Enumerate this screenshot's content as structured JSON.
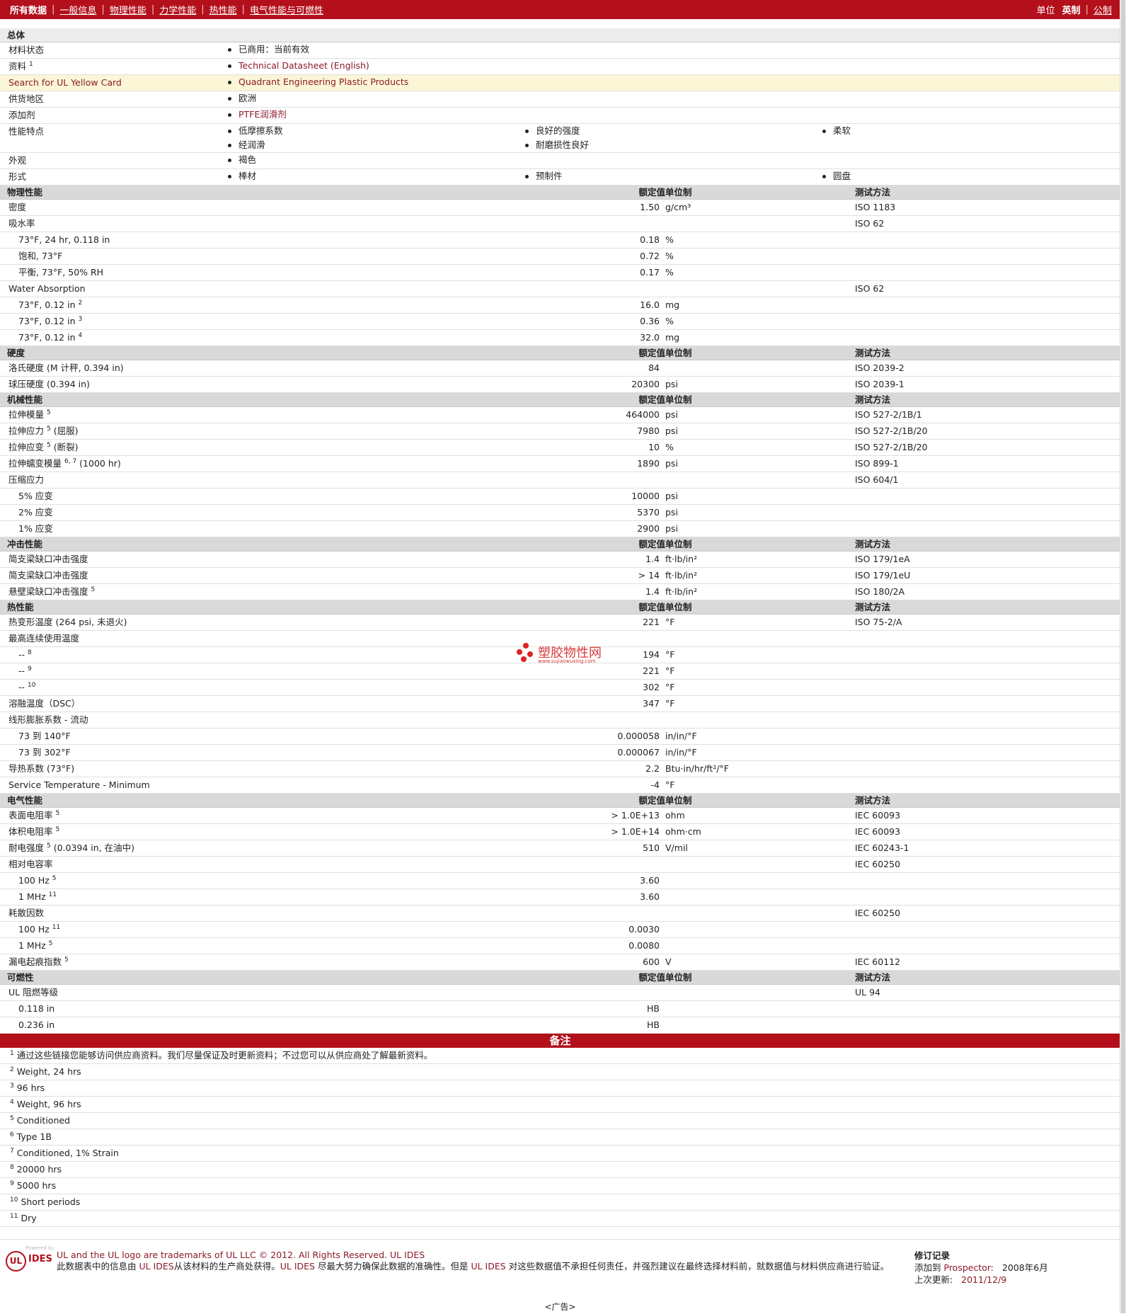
{
  "topbar": {
    "all_data": "所有数据",
    "tabs": [
      "一般信息",
      "物理性能",
      "力学性能",
      "热性能",
      "电气性能与可燃性"
    ],
    "units_label": "单位",
    "unit_active": "英制",
    "unit_other": "公制"
  },
  "general": {
    "section": "总体",
    "status_label": "材料状态",
    "status_value": "已商用：当前有效",
    "source_label": "资料",
    "source_sup": "1",
    "source_value": "Technical Datasheet (English)",
    "ul_label": "Search for UL Yellow Card",
    "ul_value": "Quadrant Engineering Plastic Products",
    "region_label": "供货地区",
    "region_value": "欧洲",
    "additive_label": "添加剂",
    "additive_value": "PTFE润滑剂",
    "features_label": "性能特点",
    "features": [
      "低摩擦系数",
      "良好的强度",
      "柔软",
      "经润滑",
      "耐磨损性良好"
    ],
    "appearance_label": "外观",
    "appearance_value": "褐色",
    "form_label": "形式",
    "forms": [
      "棒材",
      "预制件",
      "圆盘"
    ]
  },
  "headers": {
    "value": "额定值",
    "unit": "单位制",
    "test": "测试方法"
  },
  "physical": {
    "section": "物理性能",
    "rows": [
      {
        "label": "密度",
        "sup": "",
        "extra": "",
        "indent": false,
        "value": "1.50",
        "unit": "g/cm³",
        "test": "ISO 1183"
      },
      {
        "label": "吸水率",
        "sup": "",
        "extra": "",
        "indent": false,
        "value": "",
        "unit": "",
        "test": "ISO 62"
      },
      {
        "label": "73°F, 24 hr, 0.118 in",
        "sup": "",
        "extra": "",
        "indent": true,
        "value": "0.18",
        "unit": "%",
        "test": ""
      },
      {
        "label": "饱和, 73°F",
        "sup": "",
        "extra": "",
        "indent": true,
        "value": "0.72",
        "unit": "%",
        "test": ""
      },
      {
        "label": "平衡, 73°F, 50% RH",
        "sup": "",
        "extra": "",
        "indent": true,
        "value": "0.17",
        "unit": "%",
        "test": ""
      },
      {
        "label": "Water Absorption",
        "sup": "",
        "extra": "",
        "indent": false,
        "value": "",
        "unit": "",
        "test": "ISO 62"
      },
      {
        "label": "73°F, 0.12 in",
        "sup": "2",
        "extra": "",
        "indent": true,
        "value": "16.0",
        "unit": "mg",
        "test": ""
      },
      {
        "label": "73°F, 0.12 in",
        "sup": "3",
        "extra": "",
        "indent": true,
        "value": "0.36",
        "unit": "%",
        "test": ""
      },
      {
        "label": "73°F, 0.12 in",
        "sup": "4",
        "extra": "",
        "indent": true,
        "value": "32.0",
        "unit": "mg",
        "test": ""
      }
    ]
  },
  "hardness": {
    "section": "硬度",
    "rows": [
      {
        "label": "洛氏硬度",
        "sup": "",
        "extra": "(M 计秤, 0.394 in)",
        "indent": false,
        "value": "84",
        "unit": "",
        "test": "ISO 2039-2"
      },
      {
        "label": "球压硬度",
        "sup": "",
        "extra": "(0.394 in)",
        "indent": false,
        "value": "20300",
        "unit": "psi",
        "test": "ISO 2039-1"
      }
    ]
  },
  "mechanical": {
    "section": "机械性能",
    "rows": [
      {
        "label": "拉伸模量",
        "sup": "5",
        "extra": "",
        "indent": false,
        "value": "464000",
        "unit": "psi",
        "test": "ISO 527-2/1B/1"
      },
      {
        "label": "拉伸应力",
        "sup": "5",
        "extra": "(屈服)",
        "indent": false,
        "value": "7980",
        "unit": "psi",
        "test": "ISO 527-2/1B/20"
      },
      {
        "label": "拉伸应变",
        "sup": "5",
        "extra": "(断裂)",
        "indent": false,
        "value": "10",
        "unit": "%",
        "test": "ISO 527-2/1B/20"
      },
      {
        "label": "拉伸蠕变模量",
        "sup": "6, 7",
        "extra": "(1000 hr)",
        "indent": false,
        "value": "1890",
        "unit": "psi",
        "test": "ISO 899-1"
      },
      {
        "label": "压缩应力",
        "sup": "",
        "extra": "",
        "indent": false,
        "value": "",
        "unit": "",
        "test": "ISO 604/1"
      },
      {
        "label": "5% 应变",
        "sup": "",
        "extra": "",
        "indent": true,
        "value": "10000",
        "unit": "psi",
        "test": ""
      },
      {
        "label": "2% 应变",
        "sup": "",
        "extra": "",
        "indent": true,
        "value": "5370",
        "unit": "psi",
        "test": ""
      },
      {
        "label": "1% 应变",
        "sup": "",
        "extra": "",
        "indent": true,
        "value": "2900",
        "unit": "psi",
        "test": ""
      }
    ]
  },
  "impact": {
    "section": "冲击性能",
    "rows": [
      {
        "label": "简支梁缺口冲击强度",
        "sup": "",
        "extra": "",
        "indent": false,
        "value": "1.4",
        "unit": "ft·lb/in²",
        "test": "ISO 179/1eA"
      },
      {
        "label": "简支梁缺口冲击强度",
        "sup": "",
        "extra": "",
        "indent": false,
        "value": "> 14",
        "unit": "ft·lb/in²",
        "test": "ISO 179/1eU"
      },
      {
        "label": "悬壁梁缺口冲击强度",
        "sup": "5",
        "extra": "",
        "indent": false,
        "value": "1.4",
        "unit": "ft·lb/in²",
        "test": "ISO 180/2A"
      }
    ]
  },
  "thermal": {
    "section": "热性能",
    "rows": [
      {
        "label": "热变形温度",
        "sup": "",
        "extra": "(264 psi, 未退火)",
        "indent": false,
        "value": "221",
        "unit": "°F",
        "test": "ISO 75-2/A"
      },
      {
        "label": "最高连续使用温度",
        "sup": "",
        "extra": "",
        "indent": false,
        "value": "",
        "unit": "",
        "test": ""
      },
      {
        "label": "--",
        "sup": "8",
        "extra": "",
        "indent": true,
        "value": "194",
        "unit": "°F",
        "test": ""
      },
      {
        "label": "--",
        "sup": "9",
        "extra": "",
        "indent": true,
        "value": "221",
        "unit": "°F",
        "test": ""
      },
      {
        "label": "--",
        "sup": "10",
        "extra": "",
        "indent": true,
        "value": "302",
        "unit": "°F",
        "test": ""
      },
      {
        "label": "溶融温度（DSC）",
        "sup": "",
        "extra": "",
        "indent": false,
        "value": "347",
        "unit": "°F",
        "test": ""
      },
      {
        "label": "线形膨胀系数 - 流动",
        "sup": "",
        "extra": "",
        "indent": false,
        "value": "",
        "unit": "",
        "test": ""
      },
      {
        "label": "73 到 140°F",
        "sup": "",
        "extra": "",
        "indent": true,
        "value": "0.000058",
        "unit": "in/in/°F",
        "test": ""
      },
      {
        "label": "73 到 302°F",
        "sup": "",
        "extra": "",
        "indent": true,
        "value": "0.000067",
        "unit": "in/in/°F",
        "test": ""
      },
      {
        "label": "导热系数",
        "sup": "",
        "extra": "(73°F)",
        "indent": false,
        "value": "2.2",
        "unit": "Btu·in/hr/ft²/°F",
        "test": ""
      },
      {
        "label": "Service Temperature - Minimum",
        "sup": "",
        "extra": "",
        "indent": false,
        "value": "-4",
        "unit": "°F",
        "test": ""
      }
    ]
  },
  "electrical": {
    "section": "电气性能",
    "rows": [
      {
        "label": "表面电阻率",
        "sup": "5",
        "extra": "",
        "indent": false,
        "value": "> 1.0E+13",
        "unit": "ohm",
        "test": "IEC 60093"
      },
      {
        "label": "体积电阻率",
        "sup": "5",
        "extra": "",
        "indent": false,
        "value": "> 1.0E+14",
        "unit": "ohm·cm",
        "test": "IEC 60093"
      },
      {
        "label": "耐电强度",
        "sup": "5",
        "extra": "(0.0394 in, 在油中)",
        "indent": false,
        "value": "510",
        "unit": "V/mil",
        "test": "IEC 60243-1"
      },
      {
        "label": "相对电容率",
        "sup": "",
        "extra": "",
        "indent": false,
        "value": "",
        "unit": "",
        "test": "IEC 60250"
      },
      {
        "label": "100 Hz",
        "sup": "5",
        "extra": "",
        "indent": true,
        "value": "3.60",
        "unit": "",
        "test": ""
      },
      {
        "label": "1 MHz",
        "sup": "11",
        "extra": "",
        "indent": true,
        "value": "3.60",
        "unit": "",
        "test": ""
      },
      {
        "label": "耗散因数",
        "sup": "",
        "extra": "",
        "indent": false,
        "value": "",
        "unit": "",
        "test": "IEC 60250"
      },
      {
        "label": "100 Hz",
        "sup": "11",
        "extra": "",
        "indent": true,
        "value": "0.0030",
        "unit": "",
        "test": ""
      },
      {
        "label": "1 MHz",
        "sup": "5",
        "extra": "",
        "indent": true,
        "value": "0.0080",
        "unit": "",
        "test": ""
      },
      {
        "label": "漏电起痕指数",
        "sup": "5",
        "extra": "",
        "indent": false,
        "value": "600",
        "unit": "V",
        "test": "IEC 60112"
      }
    ]
  },
  "flammability": {
    "section": "可燃性",
    "rows": [
      {
        "label": "UL 阻燃等级",
        "sup": "",
        "extra": "",
        "indent": false,
        "value": "",
        "unit": "",
        "test": "UL 94"
      },
      {
        "label": "0.118 in",
        "sup": "",
        "extra": "",
        "indent": true,
        "value": "HB",
        "unit": "",
        "test": ""
      },
      {
        "label": "0.236 in",
        "sup": "",
        "extra": "",
        "indent": true,
        "value": "HB",
        "unit": "",
        "test": ""
      }
    ]
  },
  "notes": {
    "title": "备注",
    "items": [
      {
        "n": "1",
        "text": "通过这些链接您能够访问供应商资料。我们尽量保证及时更新资料；不过您可以从供应商处了解最新资料。"
      },
      {
        "n": "2",
        "text": "Weight, 24 hrs"
      },
      {
        "n": "3",
        "text": "96 hrs"
      },
      {
        "n": "4",
        "text": "Weight, 96 hrs"
      },
      {
        "n": "5",
        "text": "Conditioned"
      },
      {
        "n": "6",
        "text": "Type 1B"
      },
      {
        "n": "7",
        "text": "Conditioned, 1% Strain"
      },
      {
        "n": "8",
        "text": "20000 hrs"
      },
      {
        "n": "9",
        "text": "5000 hrs"
      },
      {
        "n": "10",
        "text": "Short periods"
      },
      {
        "n": "11",
        "text": "Dry"
      }
    ]
  },
  "footer": {
    "powered": "Powered by",
    "logo_ul": "UL",
    "logo_ides": "IDES",
    "line1": "UL and the UL logo are trademarks of UL LLC © 2012. All Rights Reserved. UL IDES",
    "line2_a": "此数据表中的信息由",
    "line2_b": "UL IDES",
    "line2_c": "从该材料的生产商处获得。",
    "line2_d": "UL IDES",
    "line2_e": "尽最大努力确保此数据的准确性。但是",
    "line2_f": "UL IDES",
    "line2_g": "对这些数据值不承担任何责任，并强烈建议在最终选择材料前，就数据值与材料供应商进行验证。",
    "rev_title": "修订记录",
    "rev_added_label": "添加到",
    "rev_added_link": "Prospector:",
    "rev_added_date": "2008年6月",
    "rev_updated_label": "上次更新:",
    "rev_updated_date": "2011/12/9",
    "ad": "<广告>"
  },
  "watermark": {
    "text": "塑胶物性网",
    "url": "www.sujiaowuxing.com"
  },
  "colors": {
    "brand_red": "#b3101c",
    "link": "#8b1a2a",
    "highlight": "#fbf6d6",
    "section_bg": "#d9d9d9"
  }
}
